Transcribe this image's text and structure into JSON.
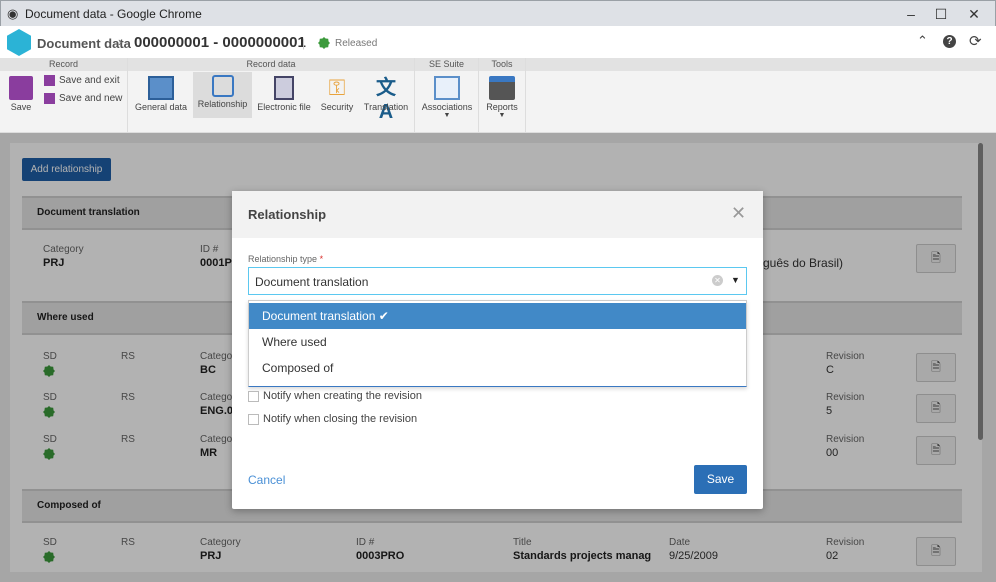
{
  "window": {
    "title": "Document data - Google Chrome"
  },
  "header": {
    "breadcrumb_root": "Document data",
    "record_id": "000000001 - 0000000001",
    "status": "Released",
    "status_color": "#3c9a3c",
    "accent": "#2bb3d6"
  },
  "ribbon": {
    "groups": [
      "Record",
      "Record data",
      "SE Suite",
      "Tools"
    ],
    "save": "Save",
    "save_exit": "Save and exit",
    "save_new": "Save and new",
    "buttons": [
      "General data",
      "Relationship",
      "Electronic file",
      "Security",
      "Translation"
    ],
    "associations": "Associations",
    "reports": "Reports"
  },
  "main": {
    "add_button": "Add relationship",
    "sections": [
      {
        "title": "Document translation",
        "rows": [
          {
            "category_label": "Category",
            "category": "PRJ",
            "id_label": "ID #",
            "id": "0001P",
            "extra": "guês do Brasil)"
          }
        ]
      },
      {
        "title": "Where used",
        "rows": [
          {
            "sd": "SD",
            "rs": "RS",
            "category_label": "Categor",
            "category": "BC",
            "revision_label": "Revision",
            "revision": "C"
          },
          {
            "sd": "SD",
            "rs": "RS",
            "category_label": "Categor",
            "category": "ENG.0",
            "revision_label": "Revision",
            "revision": "5"
          },
          {
            "sd": "SD",
            "rs": "RS",
            "category_label": "Categor",
            "category": "MR",
            "revision_label": "Revision",
            "revision": "00"
          }
        ]
      },
      {
        "title": "Composed of",
        "rows": [
          {
            "sd": "SD",
            "rs": "RS",
            "category_label": "Category",
            "category": "PRJ",
            "id_label": "ID #",
            "id": "0003PRO",
            "title_label": "Title",
            "title": "Standards projects manag",
            "date_label": "Date",
            "date": "9/25/2009",
            "revision_label": "Revision",
            "revision": "02"
          }
        ]
      }
    ]
  },
  "modal": {
    "title": "Relationship",
    "field_label": "Relationship type",
    "required_mark": "*",
    "value": "Document translation",
    "options": [
      "Document translation",
      "Where used",
      "Composed of"
    ],
    "selected_index": 0,
    "checkboxes": [
      "Notify when creating the revision",
      "Notify when closing the revision"
    ],
    "cancel": "Cancel",
    "save": "Save",
    "accent": "#2b6fb6"
  }
}
